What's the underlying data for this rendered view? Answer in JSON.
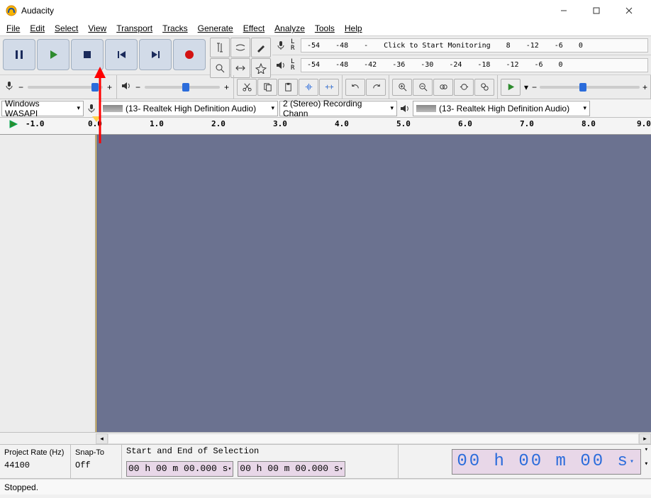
{
  "app": {
    "title": "Audacity"
  },
  "menu": [
    "File",
    "Edit",
    "Select",
    "View",
    "Transport",
    "Tracks",
    "Generate",
    "Effect",
    "Analyze",
    "Tools",
    "Help"
  ],
  "meter": {
    "rec_ticks": [
      "-54",
      "-48",
      "-",
      "Click to Start Monitoring",
      "8",
      "-12",
      "-6",
      "0"
    ],
    "play_ticks": [
      "-54",
      "-48",
      "-42",
      "-36",
      "-30",
      "-24",
      "-18",
      "-12",
      "-6",
      "0"
    ],
    "l": "L",
    "r": "R"
  },
  "devices": {
    "host": "Windows WASAPI",
    "rec_dev": " (13- Realtek High Definition Audio)",
    "channels": "2 (Stereo) Recording Chann",
    "play_dev": " (13- Realtek High Definition Audio)"
  },
  "timeline": [
    "1.0",
    "0.0",
    "1.0",
    "2.0",
    "3.0",
    "4.0",
    "5.0",
    "6.0",
    "7.0",
    "8.0",
    "9.0"
  ],
  "selbar": {
    "project_rate_lbl": "Project Rate (Hz)",
    "project_rate_val": "44100",
    "snap_lbl": "Snap-To",
    "snap_val": "Off",
    "selmode": "Start and End of Selection",
    "sel_start": "00 h 00 m 00.000 s",
    "sel_end": "00 h 00 m 00.000 s",
    "audiopos": "00 h 00 m 00 s"
  },
  "status": "Stopped."
}
